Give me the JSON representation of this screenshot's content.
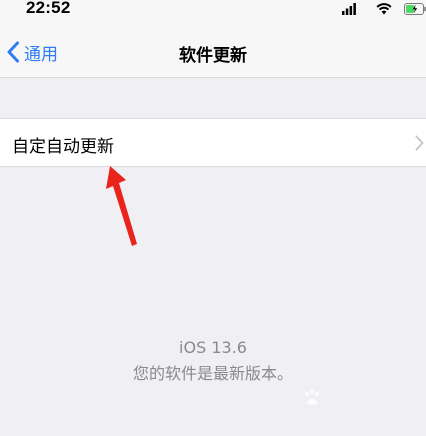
{
  "status_bar": {
    "time": "22:52",
    "icons": [
      "signal-icon",
      "wifi-icon",
      "battery-icon"
    ]
  },
  "nav": {
    "back_label": "通用",
    "title": "软件更新",
    "accent_color": "#2f7df6"
  },
  "settings_row": {
    "label": "自定自动更新"
  },
  "info": {
    "version": "iOS 13.6",
    "status": "您的软件是最新版本。"
  },
  "colors": {
    "background": "#efeff4",
    "secondary_text": "#8a8a8e",
    "annotation_arrow": "#e8241c"
  }
}
